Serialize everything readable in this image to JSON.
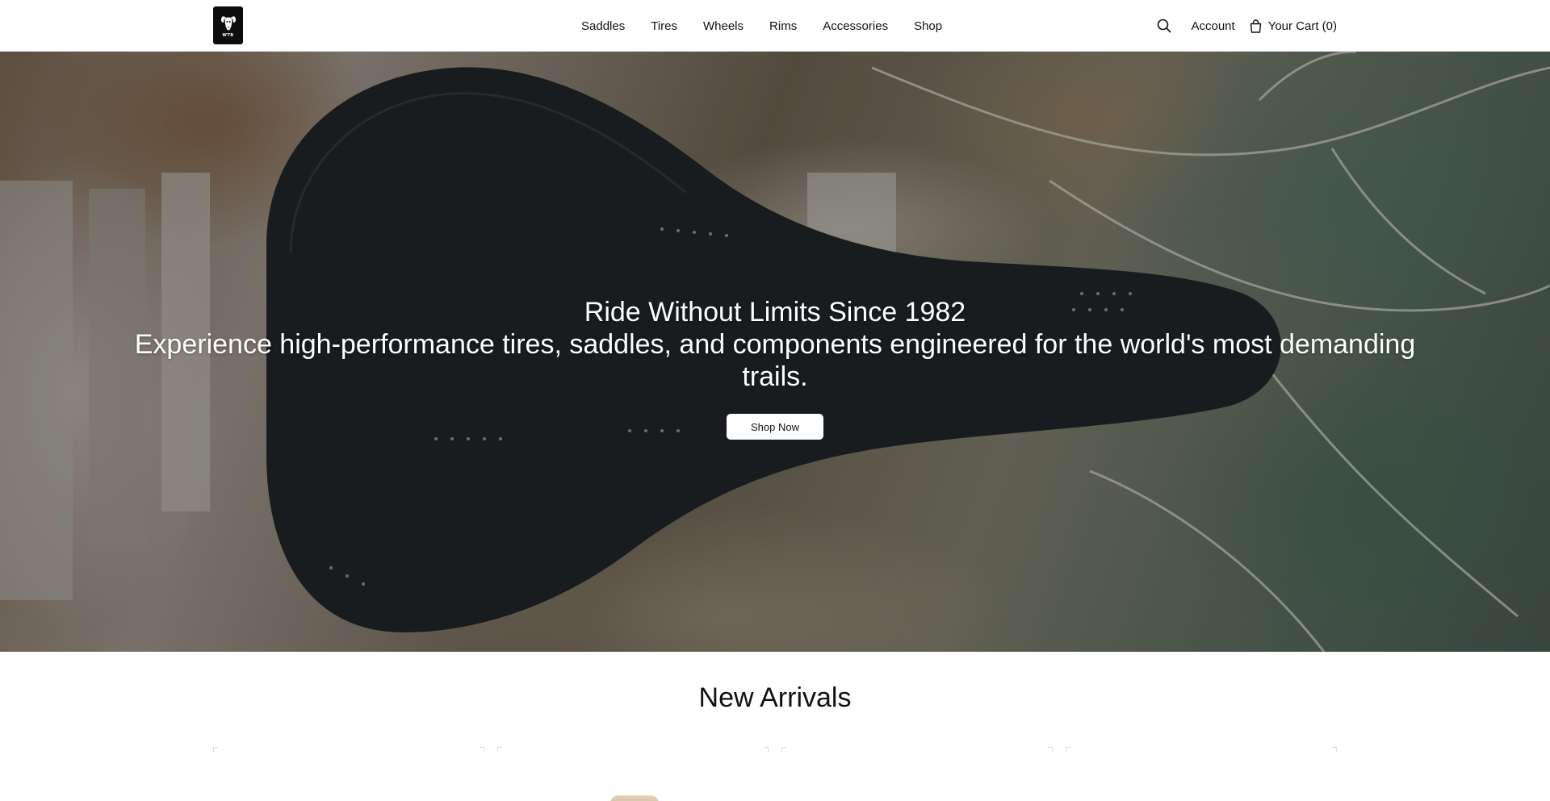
{
  "header": {
    "logo_alt": "WTB",
    "nav": [
      {
        "label": "Saddles"
      },
      {
        "label": "Tires"
      },
      {
        "label": "Wheels"
      },
      {
        "label": "Rims"
      },
      {
        "label": "Accessories"
      },
      {
        "label": "Shop"
      }
    ],
    "search_icon": "search-icon",
    "account_label": "Account",
    "cart_icon": "shopping-bag-icon",
    "cart_label": "Your Cart (0)"
  },
  "hero": {
    "title": "Ride Without Limits Since 1982",
    "subtitle": "Experience high-performance tires, saddles, and components engineered for the world's most demanding trails.",
    "cta_label": "Shop Now"
  },
  "new_arrivals": {
    "title": "New Arrivals",
    "product_count_visible": 4
  },
  "colors": {
    "background": "#ffffff",
    "text": "#111111",
    "cta_background": "#ffffff"
  }
}
